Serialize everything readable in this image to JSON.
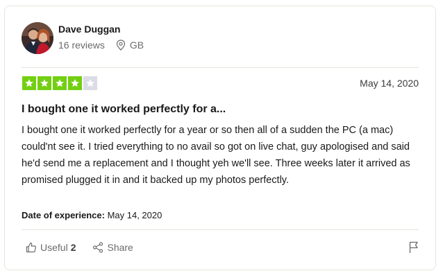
{
  "reviewer": {
    "name": "Dave Duggan",
    "reviews": "16 reviews",
    "country": "GB"
  },
  "review": {
    "rating": 4,
    "rating_max": 5,
    "date": "May 14, 2020",
    "title": "I bought one it worked perfectly for a...",
    "body": "I bought one it worked perfectly for a year or so then all of a sudden the PC (a mac) could'nt see it. I tried everything to no avail so got on live chat, guy apologised and said he'd send me a replacement and I thought yeh we'll see. Three weeks later it arrived as promised plugged it in and it backed up my photos perfectly.",
    "experience_label": "Date of experience:",
    "experience_date": "May 14, 2020"
  },
  "actions": {
    "useful_label": "Useful",
    "useful_count": "2",
    "share_label": "Share"
  },
  "colors": {
    "star_filled": "#73cf11",
    "star_empty": "#dcdce6"
  },
  "icons": [
    "location-pin-icon",
    "star-icon",
    "thumbs-up-icon",
    "share-icon",
    "flag-icon"
  ]
}
